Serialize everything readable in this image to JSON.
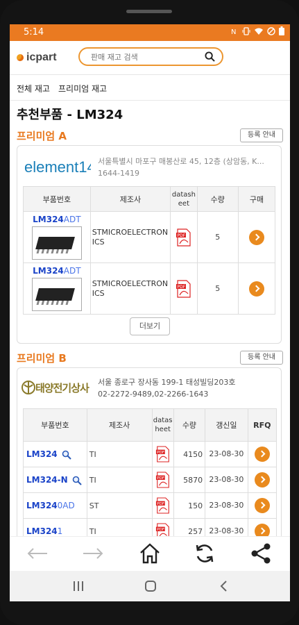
{
  "status_bar": {
    "time": "5:14"
  },
  "header": {
    "logo_text": "icpart",
    "search_placeholder": "판매 재고 검색"
  },
  "subnav": {
    "items": [
      "전체 재고",
      "프리미엄 재고"
    ]
  },
  "page_title": "추천부품 - LM324",
  "premium_a": {
    "title": "프리미엄 A",
    "register_label": "등록 안내",
    "vendor_logo": "element14",
    "address": "서울특별시 마포구 매봉산로 45, 12층 (상암동, K...",
    "phone": "1644-1419",
    "columns": [
      "부품번호",
      "제조사",
      "datasheet",
      "수량",
      "구매"
    ],
    "rows": [
      {
        "pn_main": "LM324",
        "pn_suffix": "ADT",
        "maker": "STMICROELECTRONICS",
        "qty": "5"
      },
      {
        "pn_main": "LM324",
        "pn_suffix": "ADT",
        "maker": "STMICROELECTRONICS",
        "qty": "5"
      }
    ],
    "more_label": "더보기"
  },
  "premium_b": {
    "title": "프리미엄 B",
    "register_label": "등록 안내",
    "vendor_logo": "태양전기상사",
    "address": "서울 종로구 장사동 199-1 태성빌딩203호",
    "phone": "02-2272-9489,02-2266-1643",
    "columns": [
      "부품번호",
      "제조사",
      "datasheet",
      "수량",
      "갱신일",
      "RFQ"
    ],
    "rows": [
      {
        "pn_main": "LM324",
        "pn_suffix": "",
        "maker": "TI",
        "qty": "4150",
        "date": "23-08-30"
      },
      {
        "pn_main": "LM324",
        "pn_suffix": "-N",
        "maker": "TI",
        "qty": "5870",
        "date": "23-08-30"
      },
      {
        "pn_main": "LM324",
        "pn_suffix": "0AD",
        "maker": "ST",
        "qty": "150",
        "date": "23-08-30"
      },
      {
        "pn_main": "LM324",
        "pn_suffix": "1",
        "maker": "TI",
        "qty": "257",
        "date": "23-08-30"
      }
    ]
  },
  "colors": {
    "accent": "#ea7a21",
    "link": "#1a43c8"
  },
  "icons": [
    "back-arrow-icon",
    "forward-arrow-icon",
    "home-icon",
    "refresh-icon",
    "share-icon",
    "recents-icon",
    "android-home-icon",
    "android-back-icon"
  ]
}
